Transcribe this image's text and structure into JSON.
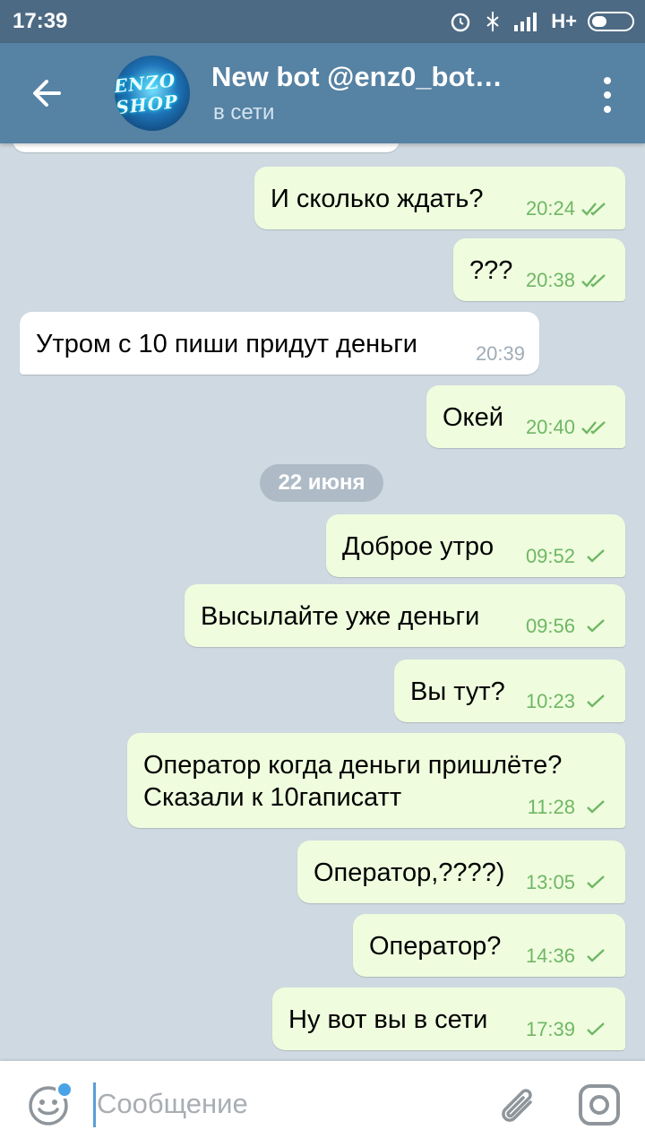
{
  "status_bar": {
    "time": "17:39",
    "network": "H+"
  },
  "header": {
    "title": "New bot @enz0_bot…",
    "status": "в сети",
    "avatar_text": "ENZO SHOP"
  },
  "date_separator": "22 июня",
  "messages": [
    {
      "dir": "out",
      "text": "И сколько ждать?",
      "time": "20:24",
      "read": true
    },
    {
      "dir": "out",
      "text": "???",
      "time": "20:38",
      "read": true
    },
    {
      "dir": "in",
      "text": "Утром с 10 пиши придут деньги",
      "time": "20:39"
    },
    {
      "dir": "out",
      "text": "Окей",
      "time": "20:40",
      "read": true
    },
    {
      "dir": "out",
      "text": "Доброе утро",
      "time": "09:52",
      "read": false
    },
    {
      "dir": "out",
      "text": "Высылайте уже деньги",
      "time": "09:56",
      "read": false
    },
    {
      "dir": "out",
      "text": "Вы тут?",
      "time": "10:23",
      "read": false
    },
    {
      "dir": "out",
      "text": "Оператор когда деньги пришлёте?",
      "text2": "Сказали к 10гаписатт",
      "time": "11:28",
      "read": false
    },
    {
      "dir": "out",
      "text": "Оператор,????)",
      "time": "13:05",
      "read": false
    },
    {
      "dir": "out",
      "text": "Оператор?",
      "time": "14:36",
      "read": false
    },
    {
      "dir": "out",
      "text": "Ну вот вы в сети",
      "time": "17:39",
      "read": false
    }
  ],
  "input": {
    "placeholder": "Сообщение",
    "value": ""
  },
  "colors": {
    "header": "#5682a3",
    "status_bar": "#4d6a84",
    "outgoing_bubble": "#effdde",
    "check": "#6fb765"
  }
}
